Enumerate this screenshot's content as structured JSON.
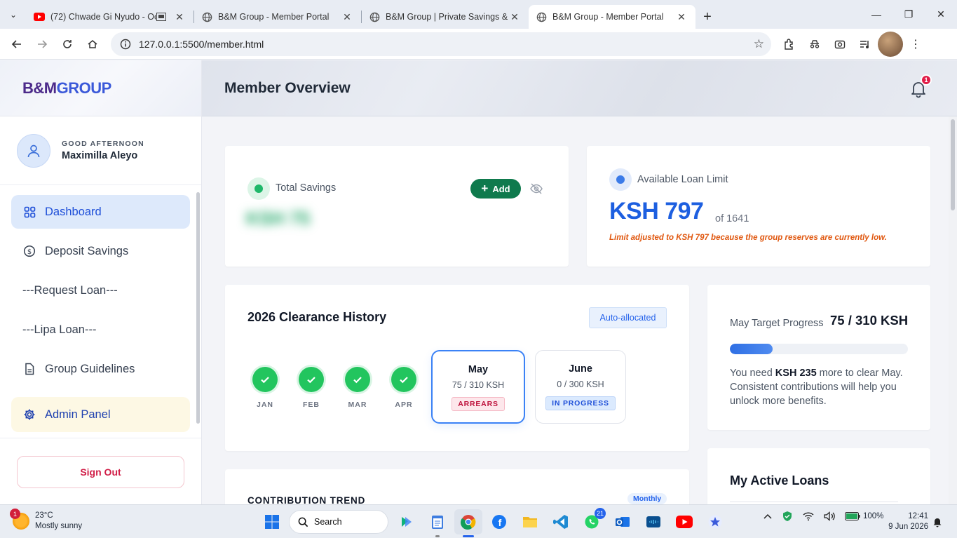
{
  "browser": {
    "tabs": [
      {
        "title": "(72) Chwade Gi Nyudo - Od",
        "icon": "youtube-icon",
        "active": false
      },
      {
        "title": "B&M Group - Member Portal",
        "icon": "globe-icon",
        "active": false
      },
      {
        "title": "B&M Group | Private Savings &",
        "icon": "globe-icon",
        "active": false
      },
      {
        "title": "B&M Group - Member Portal",
        "icon": "globe-icon",
        "active": true
      }
    ],
    "url": "127.0.0.1:5500/member.html"
  },
  "sidebar": {
    "brand_part1": "B&M",
    "brand_part2": "GROUP",
    "greeting": "GOOD AFTERNOON",
    "user_name": "Maximilla Aleyo",
    "items": [
      {
        "label": "Dashboard",
        "icon": "grid-icon"
      },
      {
        "label": "Deposit Savings",
        "icon": "dollar-circle-icon"
      },
      {
        "label": "---Request Loan---"
      },
      {
        "label": "---Lipa Loan---"
      },
      {
        "label": "Group Guidelines",
        "icon": "document-icon"
      }
    ],
    "admin_label": "Admin Panel",
    "signout_label": "Sign Out"
  },
  "header": {
    "title": "Member Overview",
    "notification_count": "1"
  },
  "savings": {
    "label": "Total Savings",
    "add_label": "Add",
    "hidden_value": "KSH 75"
  },
  "loan": {
    "label": "Available Loan Limit",
    "amount": "KSH 797",
    "of_text": "of 1641",
    "note": "Limit adjusted to KSH 797 because the group reserves are currently low."
  },
  "history": {
    "title": "2026 Clearance History",
    "badge": "Auto-allocated",
    "done_months": [
      "JAN",
      "FEB",
      "MAR",
      "APR"
    ],
    "may": {
      "name": "May",
      "amount": "75 / 310 KSH",
      "status": "ARREARS"
    },
    "june": {
      "name": "June",
      "amount": "0 / 300 KSH",
      "status": "IN PROGRESS"
    }
  },
  "target": {
    "label": "May Target Progress",
    "value": "75 / 310 KSH",
    "progress_fraction": 0.242,
    "text_pre": "You need ",
    "text_bold": "KSH 235",
    "text_post": " more to clear May. Consistent contributions will help you unlock more benefits."
  },
  "trend": {
    "title": "CONTRIBUTION TREND",
    "badge": "Monthly"
  },
  "active_loans": {
    "title": "My Active Loans"
  },
  "taskbar": {
    "weather_badge": "1",
    "temperature": "23°C",
    "condition": "Mostly sunny",
    "search_label": "Search",
    "whatsapp_badge": "21",
    "battery": "100%",
    "time": "12:41",
    "date": "9 Jun 2026"
  }
}
